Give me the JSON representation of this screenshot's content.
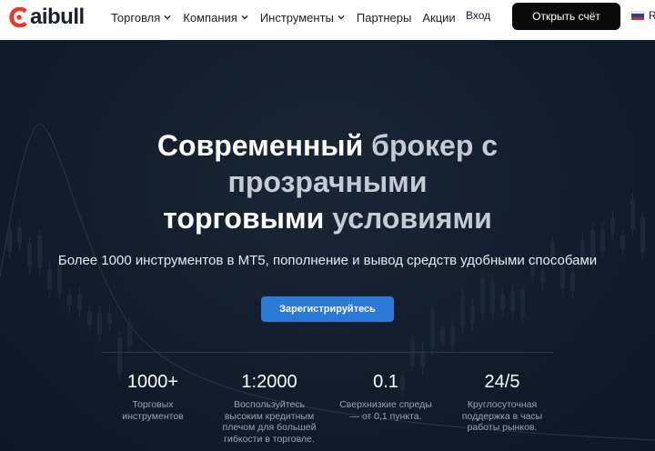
{
  "header": {
    "logo_text": "aibull",
    "nav": [
      {
        "label": "Торговля",
        "has_dropdown": true
      },
      {
        "label": "Компания",
        "has_dropdown": true
      },
      {
        "label": "Инструменты",
        "has_dropdown": true
      },
      {
        "label": "Партнеры",
        "has_dropdown": false
      },
      {
        "label": "Акции",
        "has_dropdown": false
      }
    ],
    "login_label": "Вход",
    "open_account_label": "Открыть счёт",
    "lang_label": "R",
    "lang_flag_icon": "russia-flag-icon"
  },
  "hero": {
    "title_line1_a": "Современный",
    "title_line1_b": " брокер с",
    "title_line2": "прозрачными",
    "title_line3_a": "торговыми",
    "title_line3_b": " условиями",
    "subtitle": "Более 1000 инструментов в MT5, пополнение и вывод средств удобными способами",
    "cta_label": "Зарегистрируйтесь"
  },
  "stats": [
    {
      "value": "1000+",
      "desc_lines": [
        "Торговых",
        "инструментов"
      ]
    },
    {
      "value": "1:2000",
      "desc_lines": [
        "Воспользуйтесь",
        "высоким кредитным",
        "плечом для большей",
        "гибкости в торговле."
      ]
    },
    {
      "value": "0.1",
      "desc_lines": [
        "Сверхнизкие спреды",
        "— от 0,1 пункта."
      ]
    },
    {
      "value": "24/5",
      "desc_lines": [
        "Круглосуточная",
        "поддержка в часы",
        "работы рынков."
      ]
    }
  ],
  "colors": {
    "brand_red": "#e8382b",
    "cta_blue": "#2b7ad8",
    "hero_bg": "#121c2c",
    "header_button": "#0a0a0a"
  }
}
